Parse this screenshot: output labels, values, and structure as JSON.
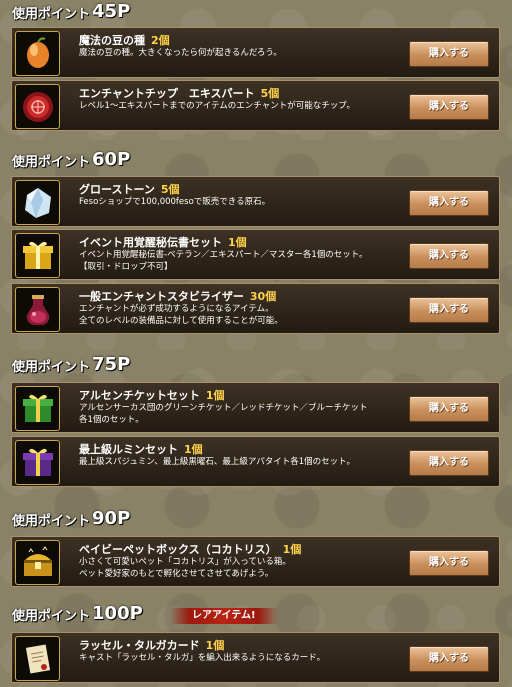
{
  "buy_label": "購入する",
  "section_label": "使用ポイント",
  "rare_badge": "レアアイテム!",
  "sections": [
    {
      "points": "45P",
      "items": [
        {
          "name": "魔法の豆の種",
          "qty": "2個",
          "icon": "magic-bean-icon",
          "desc": [
            "魔法の豆の種。大きくなったら何が起きるんだろう。"
          ]
        },
        {
          "name": "エンチャントチップ　エキスパート",
          "qty": "5個",
          "icon": "enchant-chip-icon",
          "desc": [
            "レベル1～エキスパートまでのアイテムのエンチャントが可能なチップ。"
          ]
        }
      ]
    },
    {
      "points": "60P",
      "items": [
        {
          "name": "グローストーン",
          "qty": "5個",
          "icon": "glow-stone-icon",
          "desc": [
            "Fesoショップで100,000fesoで販売できる原石。"
          ]
        },
        {
          "name": "イベント用覚醒秘伝書セット",
          "qty": "1個",
          "icon": "gold-gift-box-icon",
          "desc": [
            "イベント用覚醒秘伝書-ベテラン／エキスパート／マスター各1個のセット。",
            "【取引・ドロップ不可】"
          ]
        },
        {
          "name": "一般エンチャントスタビライザー",
          "qty": "30個",
          "icon": "stabilizer-potion-icon",
          "desc": [
            "エンチャントが必ず成功するようになるアイテム。",
            "全てのレベルの装備品に対して使用することが可能。"
          ]
        }
      ]
    },
    {
      "points": "75P",
      "items": [
        {
          "name": "アルセンチケットセット",
          "qty": "1個",
          "icon": "green-gift-box-icon",
          "desc": [
            "アルセンサーカス団のグリーンチケット／レッドチケット／ブルーチケット",
            "各1個のセット。"
          ]
        },
        {
          "name": "最上級ルミンセット",
          "qty": "1個",
          "icon": "purple-gift-box-icon",
          "desc": [
            "最上級スパジュミン、最上級黒曜石、最上級アパタイト各1個のセット。"
          ]
        }
      ]
    },
    {
      "points": "90P",
      "items": [
        {
          "name": "ベイビーペットボックス（コカトリス）",
          "qty": "1個",
          "icon": "treasure-chest-icon",
          "desc": [
            "小さくて可愛いペット「コカトリス」が入っている箱。",
            "ペット愛好家のもとで孵化させてさせてあげよう。"
          ]
        }
      ]
    },
    {
      "points": "100P",
      "rare": true,
      "items": [
        {
          "name": "ラッセル・タルガカード",
          "qty": "1個",
          "icon": "scroll-card-icon",
          "desc": [
            "キャスト「ラッセル・タルガ」を編入出来るようになるカード。"
          ]
        }
      ]
    }
  ]
}
